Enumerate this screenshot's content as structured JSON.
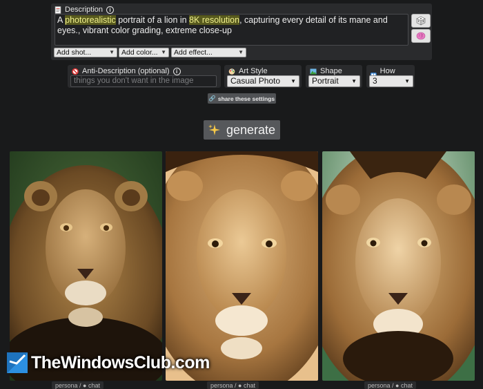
{
  "description": {
    "label": "Description",
    "text_parts": [
      {
        "text": "A ",
        "hl": false
      },
      {
        "text": "photorealistic",
        "hl": true
      },
      {
        "text": " portrait of a lion in ",
        "hl": false
      },
      {
        "text": "8K resolution",
        "hl": true
      },
      {
        "text": ", capturing every detail of its mane and eyes., vibrant color grading, extreme close-up",
        "hl": false
      }
    ],
    "dice_icon": "dice-icon",
    "brain_icon": "brain-icon"
  },
  "add_selects": {
    "shot": "Add shot...",
    "color": "Add color...",
    "effect": "Add effect..."
  },
  "anti": {
    "label": "Anti-Description (optional)",
    "placeholder": "things you don't want in the image"
  },
  "art_style": {
    "label": "Art Style",
    "value": "Casual Photo"
  },
  "shape": {
    "label": "Shape",
    "value": "Portrait"
  },
  "how_many": {
    "label": "How many?",
    "value": "3"
  },
  "share_label": "share these settings",
  "generate_label": "generate",
  "image_labels": [
    "persona / ● chat",
    "persona / ● chat",
    "persona / ● chat"
  ],
  "watermark": "TheWindowsClub.com",
  "colors": {
    "highlight_bg": "#585a1e",
    "panel": "#2a2b2d",
    "background": "#191a1b"
  }
}
